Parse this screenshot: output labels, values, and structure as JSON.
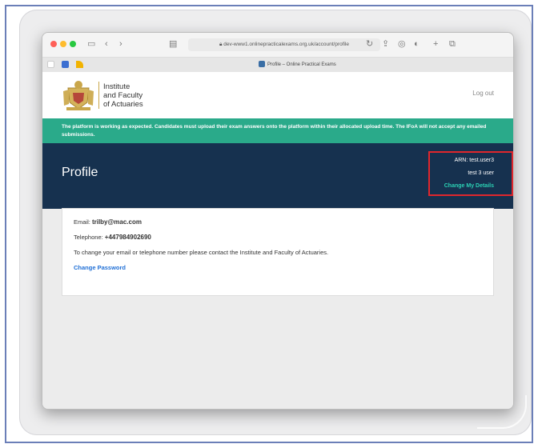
{
  "browser": {
    "url": "dev-www1.onlinepracticalexams.org.uk/account/profile",
    "tab_title": "Profile – Online Practical Exams"
  },
  "header": {
    "org_line1": "Institute",
    "org_line2": "and Faculty",
    "org_line3": "of Actuaries",
    "logout": "Log out"
  },
  "banner": {
    "text": "The platform is working as expected. Candidates must upload their exam answers onto the platform within their allocated upload time. The IFoA will not accept any emailed submissions."
  },
  "hero": {
    "title": "Profile",
    "arn": "ARN: test.user3",
    "name": "test 3 user",
    "change_details": "Change My Details"
  },
  "profile": {
    "email_label": "Email:",
    "email": "trilby@mac.com",
    "phone_label": "Telephone:",
    "phone": "+447984902690",
    "notice": "To change your email or telephone number please contact the Institute and Faculty of Actuaries.",
    "change_password": "Change Password"
  },
  "colors": {
    "banner": "#2aaa8a",
    "hero": "#16314f",
    "link": "#1f6fd6",
    "accent": "#2bd0b3",
    "highlight": "#e0262c"
  }
}
